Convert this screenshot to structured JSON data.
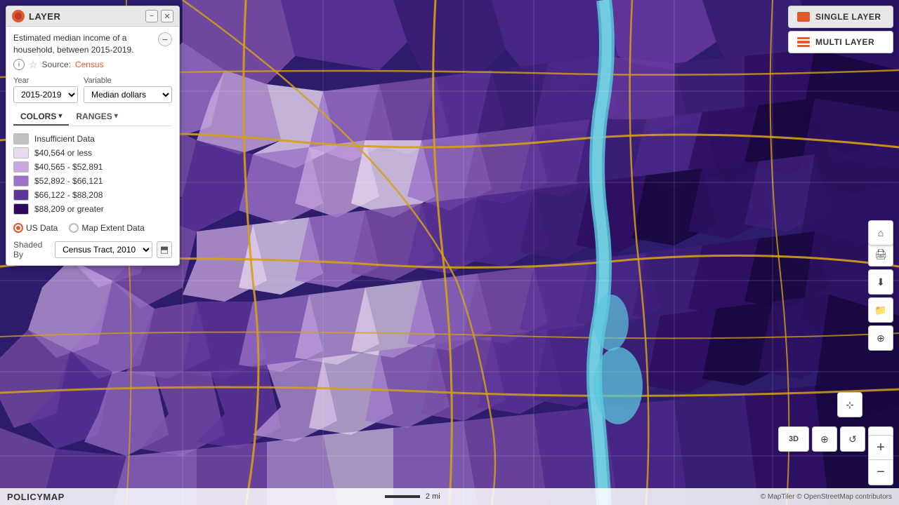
{
  "panel": {
    "title": "LAYER",
    "description": "Estimated median income of a household, between 2015-2019.",
    "source_label": "Source:",
    "source_link": "Census",
    "year_label": "Year",
    "year_value": "2015-2019",
    "variable_label": "Variable",
    "variable_value": "Median dollars",
    "tab_colors": "COLORS",
    "tab_ranges": "RANGES",
    "legend": [
      {
        "label": "Insufficient Data",
        "color": "#c0c0c0"
      },
      {
        "label": "$40,564 or less",
        "color": "#e8d8f0"
      },
      {
        "label": "$40,565 - $52,891",
        "color": "#c9a8e0"
      },
      {
        "label": "$52,892 - $66,121",
        "color": "#9b72c8"
      },
      {
        "label": "$66,122 - $88,208",
        "color": "#5c3598"
      },
      {
        "label": "$88,209 or greater",
        "color": "#2d0a5c"
      }
    ],
    "radio_us": "US Data",
    "radio_extent": "Map Extent Data",
    "shaded_by_label": "Shaded By",
    "shaded_by_value": "Census Tract, 2010"
  },
  "layer_switcher": {
    "single_label": "SINGLE LAYER",
    "multi_label": "MULTI LAYER"
  },
  "map_controls": {
    "zoom_in": "+",
    "zoom_out": "−",
    "three_d": "3D",
    "rotate": "↺",
    "settings": "⚙"
  },
  "bottom_bar": {
    "logo": "POLICYMAP",
    "scale": "2 mi",
    "attribution": "© MapTiler © OpenStreetMap contributors"
  }
}
